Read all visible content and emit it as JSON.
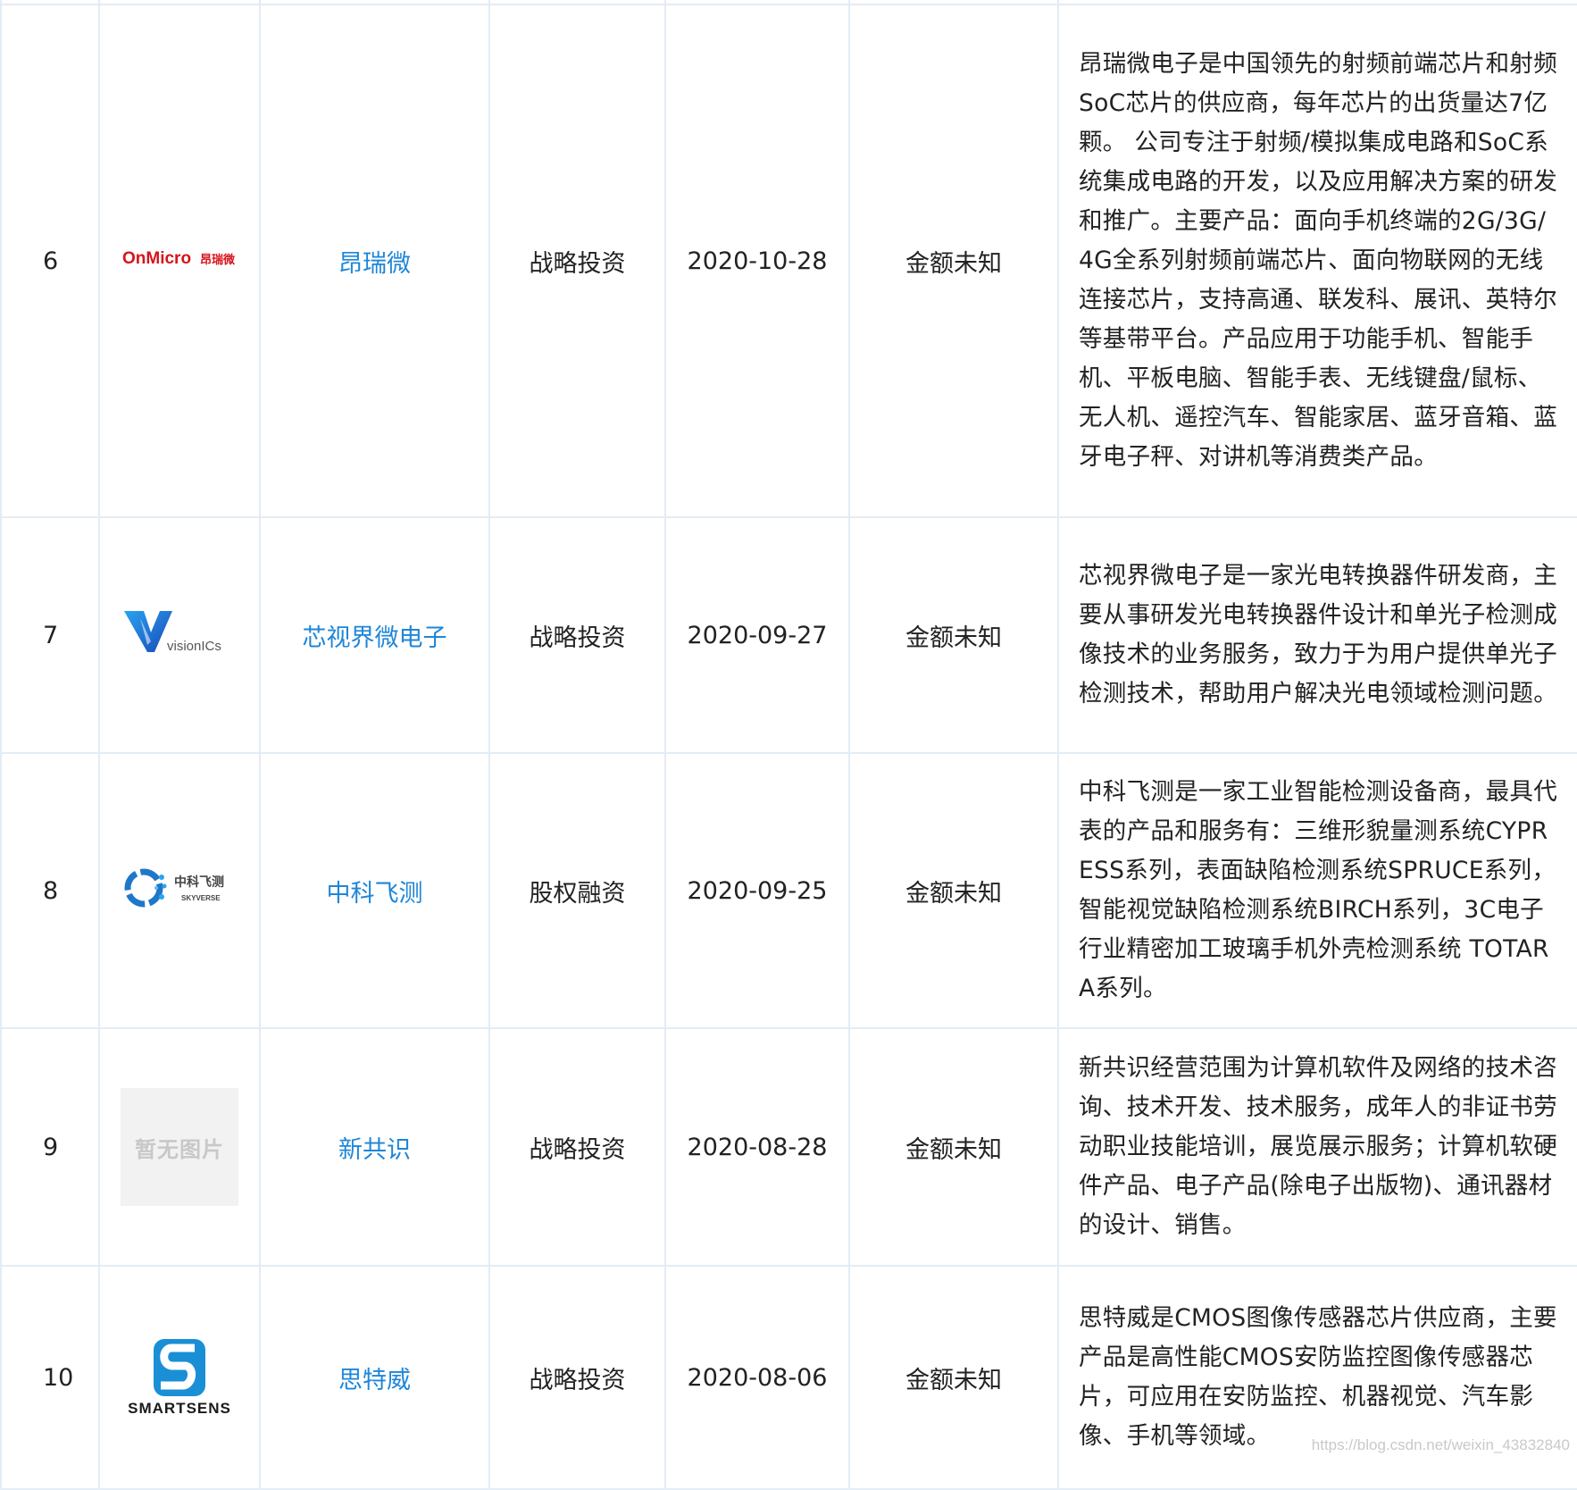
{
  "rows": [
    {
      "num": "6",
      "logo": {
        "type": "onmicro",
        "text": "OnMicro",
        "cn_text": "昂瑞微",
        "color": "#d7131b"
      },
      "name": "昂瑞微",
      "round": "战略投资",
      "date": "2020-10-28",
      "amount": "金额未知",
      "desc": "昂瑞微电子是中国领先的射频前端芯片和射频SoC芯片的供应商，每年芯片的出货量达7亿颗。 公司专注于射频/模拟集成电路和SoC系统集成电路的开发，以及应用解决方案的研发和推广。主要产品：面向手机终端的2G/3G/4G全系列射频前端芯片、面向物联网的无线连接芯片，支持高通、联发科、展讯、英特尔等基带平台。产品应用于功能手机、智能手机、平板电脑、智能手表、无线键盘/鼠标、无人机、遥控汽车、智能家居、蓝牙音箱、蓝牙电子秤、对讲机等消费类产品。"
    },
    {
      "num": "7",
      "logo": {
        "type": "visionics",
        "text": "visionICs",
        "color": "#1f6fd1"
      },
      "name": "芯视界微电子",
      "round": "战略投资",
      "date": "2020-09-27",
      "amount": "金额未知",
      "desc": "芯视界微电子是一家光电转换器件研发商，主要从事研发光电转换器件设计和单光子检测成像技术的业务服务，致力于为用户提供单光子检测技术，帮助用户解决光电领域检测问题。"
    },
    {
      "num": "8",
      "logo": {
        "type": "skyverse",
        "text": "中科飞测",
        "subtext": "SKYVERSE",
        "color": "#1f77c8"
      },
      "name": "中科飞测",
      "round": "股权融资",
      "date": "2020-09-25",
      "amount": "金额未知",
      "desc": "中科飞测是一家工业智能检测设备商，最具代表的产品和服务有：三维形貌量测系统CYPRESS系列，表面缺陷检测系统SPRUCE系列，智能视觉缺陷检测系统BIRCH系列，3C电子行业精密加工玻璃手机外壳检测系统 TOTARA系列。"
    },
    {
      "num": "9",
      "logo": {
        "type": "placeholder",
        "text": "暂无图片"
      },
      "name": "新共识",
      "round": "战略投资",
      "date": "2020-08-28",
      "amount": "金额未知",
      "desc": "新共识经营范围为计算机软件及网络的技术咨询、技术开发、技术服务，成年人的非证书劳动职业技能培训，展览展示服务；计算机软硬件产品、电子产品(除电子出版物)、通讯器材的设计、销售。"
    },
    {
      "num": "10",
      "logo": {
        "type": "smartsens",
        "text": "SMARTSENS",
        "color": "#1a8fd6"
      },
      "name": "思特威",
      "round": "战略投资",
      "date": "2020-08-06",
      "amount": "金额未知",
      "desc": "思特威是CMOS图像传感器芯片供应商，主要产品是高性能CMOS安防监控图像传感器芯片，可应用在安防监控、机器视觉、汽车影像、手机等领域。"
    }
  ],
  "watermark": "https://blog.csdn.net/weixin_43832840"
}
